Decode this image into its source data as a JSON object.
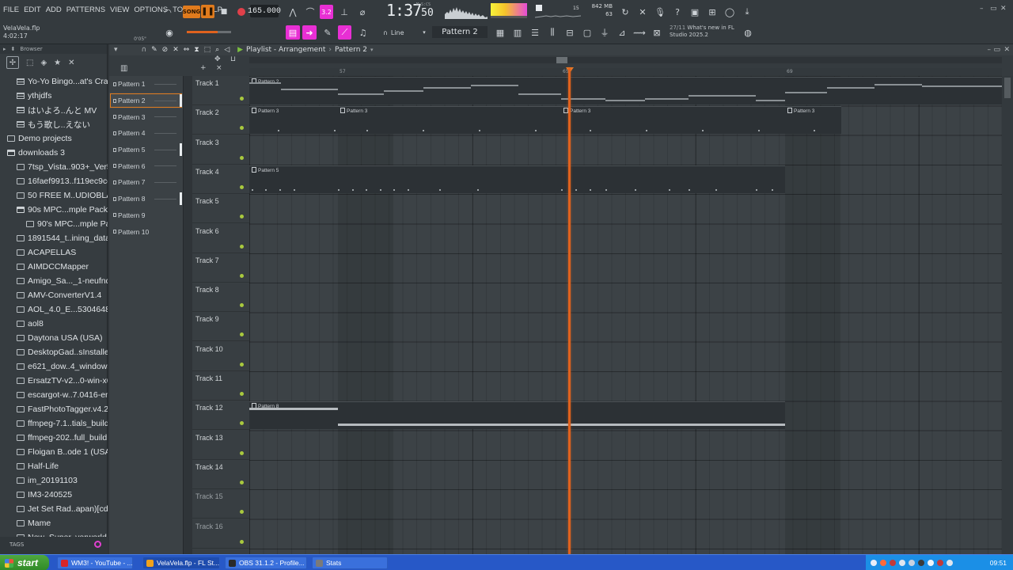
{
  "menu": [
    "FILE",
    "EDIT",
    "ADD",
    "PATTERNS",
    "VIEW",
    "OPTIONS",
    "TOOLS",
    "HELP"
  ],
  "song": {
    "file": "VelaVela.flp",
    "time": "4:02:17"
  },
  "transport": {
    "song_label": "SONG",
    "tempo": "165.000",
    "pat_label": "3.2"
  },
  "clock": {
    "main": "1:37",
    "sub": "50",
    "unit": "M:S:CS"
  },
  "memory": {
    "mb": "842 MB",
    "voices": "63",
    "poly": "15",
    "cpu": "0"
  },
  "snap": {
    "label": "Line",
    "time_offset": "0'05\""
  },
  "pattern_selector": "Pattern 2",
  "news": {
    "date": "27/11",
    "line1": "What's new in FL",
    "line2": "Studio 2025.2"
  },
  "browser": {
    "title": "Browser",
    "items": [
      {
        "label": "Yo-Yo Bingo...at's Cradle",
        "type": "doc",
        "indent": 1
      },
      {
        "label": "ythjdfs",
        "type": "doc",
        "indent": 1
      },
      {
        "label": "はいよろ..んと MV",
        "type": "doc",
        "indent": 1
      },
      {
        "label": "もう歌し..えない",
        "type": "doc",
        "indent": 1
      },
      {
        "label": "Demo projects",
        "type": "fold",
        "indent": 0
      },
      {
        "label": "downloads 3",
        "type": "fold-open",
        "indent": 0
      },
      {
        "label": "7tsp_Vista..903+_Ver5",
        "type": "fold",
        "indent": 1
      },
      {
        "label": "16faef9913..f119ec9cd",
        "type": "fold",
        "indent": 1
      },
      {
        "label": "50 FREE M..UDIOBLAST",
        "type": "fold",
        "indent": 1
      },
      {
        "label": "90s MPC...mple Pack",
        "type": "fold-open",
        "indent": 1
      },
      {
        "label": "90's MPC...mple Pack",
        "type": "fold",
        "indent": 2
      },
      {
        "label": "1891544_t..ining_data",
        "type": "fold",
        "indent": 1
      },
      {
        "label": "ACAPELLAS",
        "type": "fold",
        "indent": 1
      },
      {
        "label": "AIMDCCMapper",
        "type": "fold",
        "indent": 1
      },
      {
        "label": "Amigo_Sa..._1-neufnq",
        "type": "fold",
        "indent": 1
      },
      {
        "label": "AMV-ConverterV1.4",
        "type": "fold",
        "indent": 1
      },
      {
        "label": "AOL_4.0_E...53046485",
        "type": "fold",
        "indent": 1
      },
      {
        "label": "aol8",
        "type": "fold",
        "indent": 1
      },
      {
        "label": "Daytona USA (USA)",
        "type": "fold",
        "indent": 1
      },
      {
        "label": "DesktopGad..sInstaller",
        "type": "fold",
        "indent": 1
      },
      {
        "label": "e621_dow..4_windows",
        "type": "fold",
        "indent": 1
      },
      {
        "label": "ErsatzTV-v2...0-win-x64",
        "type": "fold",
        "indent": 1
      },
      {
        "label": "escargot-w..7.0416-en",
        "type": "fold",
        "indent": 1
      },
      {
        "label": "FastPhotoTagger.v4.2",
        "type": "fold",
        "indent": 1
      },
      {
        "label": "ffmpeg-7.1..tials_build",
        "type": "fold",
        "indent": 1
      },
      {
        "label": "ffmpeg-202..full_build",
        "type": "fold",
        "indent": 1
      },
      {
        "label": "Floigan B..ode 1 (USA)",
        "type": "fold",
        "indent": 1
      },
      {
        "label": "Half-Life",
        "type": "fold",
        "indent": 1
      },
      {
        "label": "im_20191103",
        "type": "fold",
        "indent": 1
      },
      {
        "label": "IM3-240525",
        "type": "fold",
        "indent": 1
      },
      {
        "label": "Jet Set Rad..apan)[cdi]",
        "type": "fold",
        "indent": 1
      },
      {
        "label": "Mame",
        "type": "fold",
        "indent": 1
      },
      {
        "label": "New_Super..verworld",
        "type": "fold",
        "indent": 1
      }
    ],
    "tags_label": "TAGS"
  },
  "playlist": {
    "title": "Playlist - Arrangement",
    "pattern": "Pattern 2",
    "patterns": [
      "Pattern 1",
      "Pattern 2",
      "Pattern 3",
      "Pattern 4",
      "Pattern 5",
      "Pattern 6",
      "Pattern 7",
      "Pattern 8",
      "Pattern 9",
      "Pattern 10"
    ],
    "selected_pattern": 1,
    "tracks": [
      "Track 1",
      "Track 2",
      "Track 3",
      "Track 4",
      "Track 5",
      "Track 6",
      "Track 7",
      "Track 8",
      "Track 9",
      "Track 10",
      "Track 11",
      "Track 12",
      "Track 13",
      "Track 14",
      "Track 15",
      "Track 16"
    ],
    "ruler_marks": [
      "57",
      "65",
      "69"
    ],
    "clips": [
      {
        "label": "Pattern 2",
        "track": 0,
        "start": 0,
        "end": 951,
        "kind": "line"
      },
      {
        "label": "Pattern 3",
        "track": 1,
        "start": 0,
        "end": 112,
        "kind": "ticks"
      },
      {
        "label": "Pattern 3",
        "track": 1,
        "start": 112,
        "end": 394,
        "kind": "ticks"
      },
      {
        "label": "Pattern 3",
        "track": 1,
        "start": 394,
        "end": 677,
        "kind": "ticks"
      },
      {
        "label": "Pattern 3",
        "track": 1,
        "start": 677,
        "end": 748,
        "kind": "ticks"
      },
      {
        "label": "Pattern 5",
        "track": 3,
        "start": 0,
        "end": 677,
        "kind": "dense"
      },
      {
        "label": "Pattern 8",
        "track": 11,
        "start": 0,
        "end": 677,
        "kind": "bars"
      }
    ]
  },
  "taskbar": {
    "start": "start",
    "tasks": [
      {
        "label": "WM3! - YouTube - ...",
        "color": "#d8262a"
      },
      {
        "label": "VelaVela.flp - FL St...",
        "color": "#f0a21c"
      },
      {
        "label": "OBS 31.1.2 - Profile...",
        "color": "#2a2a2a"
      },
      {
        "label": "Stats",
        "color": "#7a7a7a"
      }
    ],
    "clock": "09:51"
  }
}
